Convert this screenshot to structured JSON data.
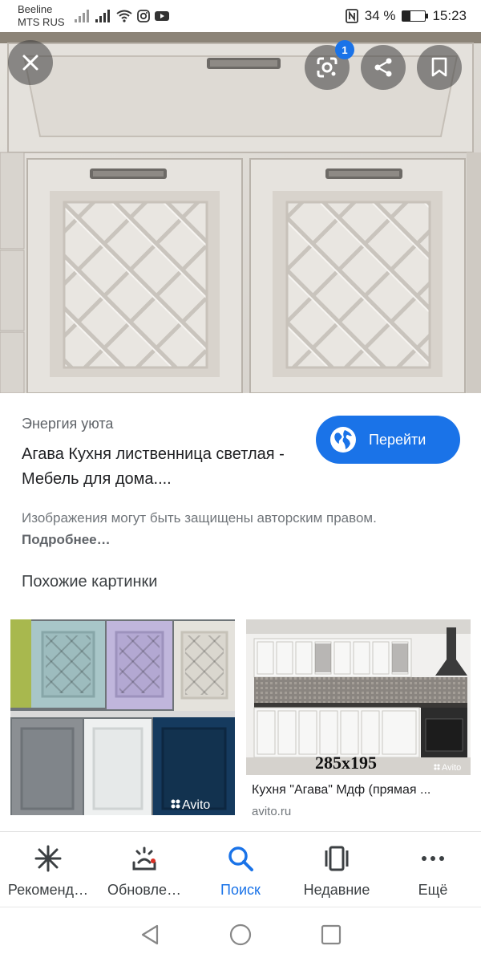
{
  "status_bar": {
    "carrier_1": "Beeline",
    "carrier_2": "MTS RUS",
    "battery_percent": "34 %",
    "battery_level": 0.34,
    "time": "15:23"
  },
  "hero": {
    "lens_badge_count": "1",
    "icons": [
      "close-icon",
      "lens-icon",
      "share-icon",
      "bookmark-icon"
    ]
  },
  "result": {
    "source": "Энергия уюта",
    "title": "Агава Кухня лиственница светлая - Мебель для дома....",
    "visit_label": "Перейти",
    "copyright_text": "Изображения могут быть защищены авторским правом.",
    "copyright_more": "Подробнее…"
  },
  "similar": {
    "heading": "Похожие картинки",
    "items": [
      {
        "watermark": "Avito"
      },
      {
        "overlay_text": "285x195",
        "watermark": "Avito",
        "caption": "Кухня \"Агава\" Мдф (прямая ...",
        "domain": "avito.ru"
      }
    ]
  },
  "bottom_nav": {
    "items": [
      {
        "label": "Рекоменд…",
        "icon": "asterisk-icon"
      },
      {
        "label": "Обновле…",
        "icon": "updates-icon"
      },
      {
        "label": "Поиск",
        "icon": "search-icon",
        "active": true
      },
      {
        "label": "Недавние",
        "icon": "recent-icon"
      },
      {
        "label": "Ещё",
        "icon": "more-icon"
      }
    ]
  },
  "colors": {
    "accent": "#1a73e8",
    "text_primary": "#202124",
    "text_secondary": "#70757a"
  }
}
